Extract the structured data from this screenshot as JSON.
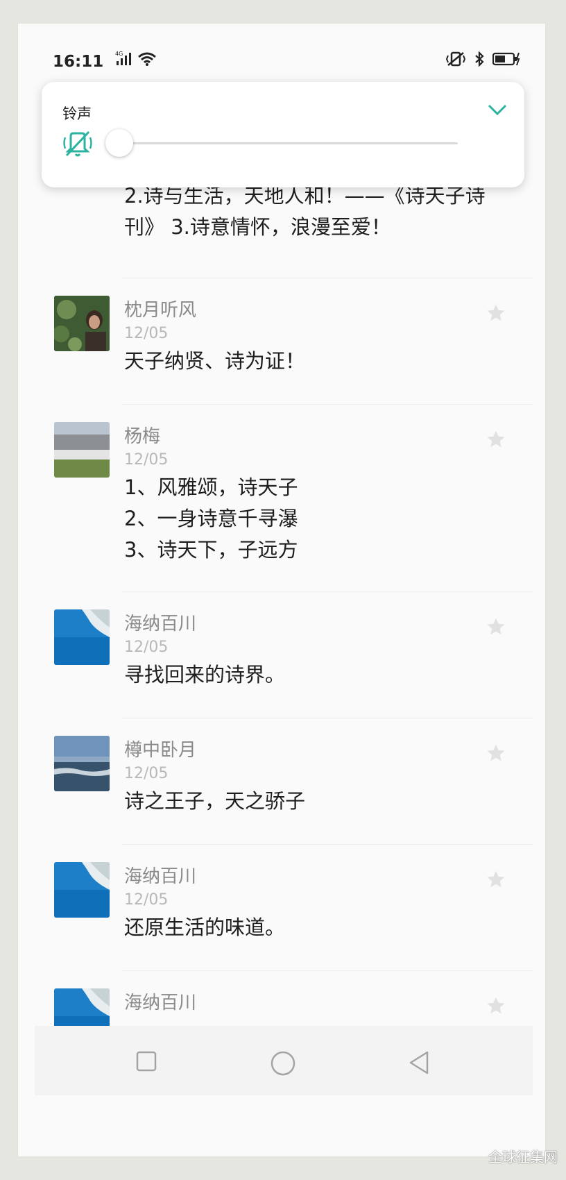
{
  "status_bar": {
    "time": "16:11",
    "network": "4G"
  },
  "volume_popup": {
    "title": "铃声",
    "level": 0,
    "accent_color": "#2bb3a0"
  },
  "list": {
    "partial_top": {
      "content": "2.诗与生活，天地人和！——《诗天子诗刊》 3.诗意情怀，浪漫至爱！",
      "line1": "2.诗与生活，天地人和！——《诗天子诗",
      "line2": "刊》 3.诗意情怀，浪漫至爱！"
    },
    "items": [
      {
        "name": "枕月听风",
        "date": "12/05",
        "lines": [
          "天子纳贤、诗为证！"
        ],
        "avatar": "plant-portrait"
      },
      {
        "name": "杨梅",
        "date": "12/05",
        "lines": [
          "1、风雅颂，诗天子",
          "2、一身诗意千寻瀑",
          "3、诗天下，子远方"
        ],
        "avatar": "arena-building"
      },
      {
        "name": "海纳百川",
        "date": "12/05",
        "lines": [
          "寻找回来的诗界。"
        ],
        "avatar": "sea-cliff"
      },
      {
        "name": "樽中卧月",
        "date": "12/05",
        "lines": [
          "诗之王子，天之骄子"
        ],
        "avatar": "sea-horizon"
      },
      {
        "name": "海纳百川",
        "date": "12/05",
        "lines": [
          "还原生活的味道。"
        ],
        "avatar": "sea-cliff"
      },
      {
        "name": "海纳百川",
        "date": "",
        "lines": [],
        "avatar": "sea-cliff"
      }
    ]
  },
  "nav_bar": {
    "buttons": [
      "recent-apps",
      "home",
      "back"
    ]
  },
  "watermark": "全球征集网"
}
